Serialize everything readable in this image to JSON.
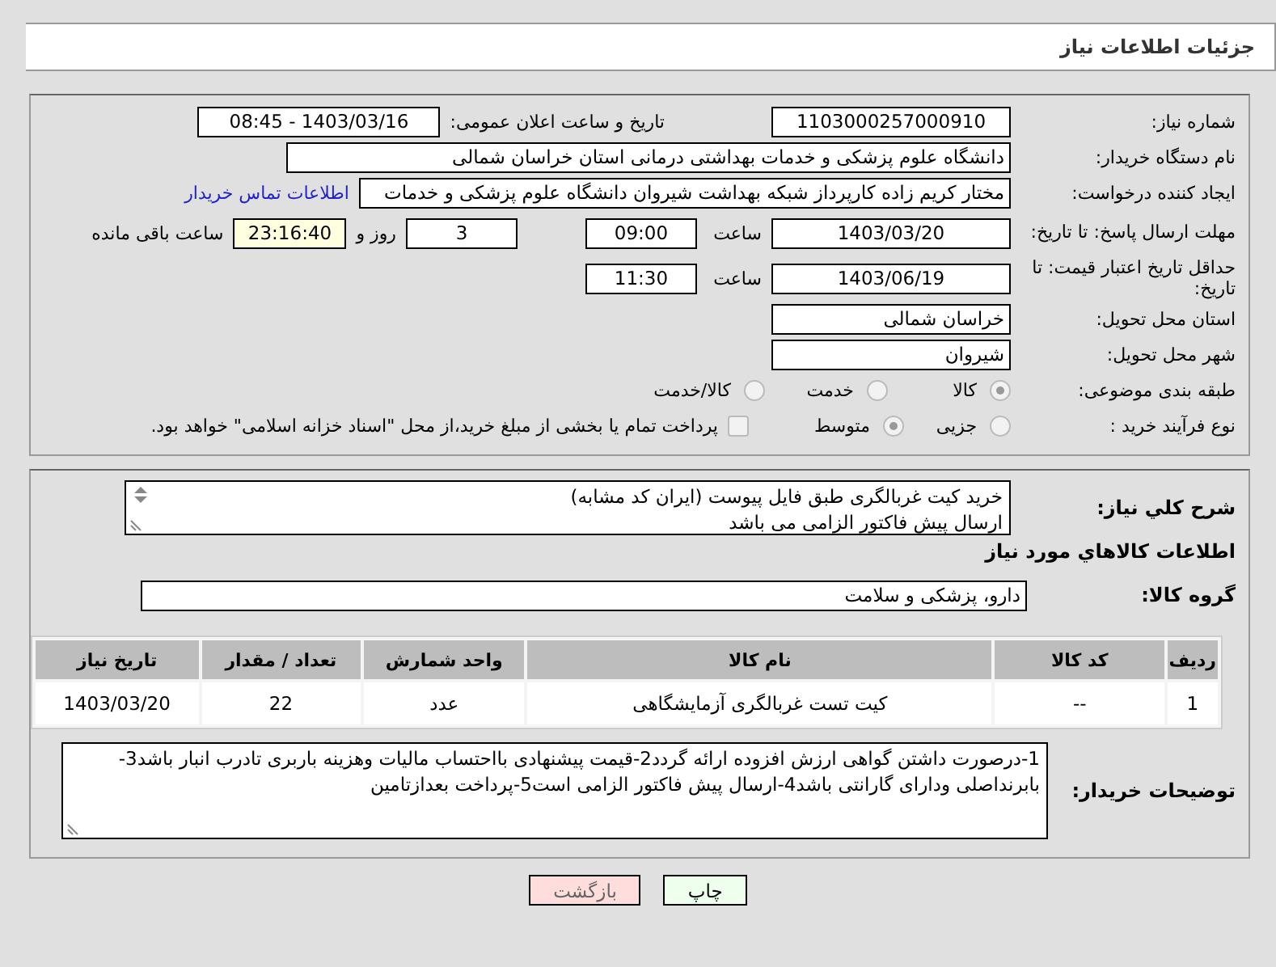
{
  "header": {
    "title": "جزئیات اطلاعات نیاز"
  },
  "need_number": {
    "label": "شماره نیاز:",
    "value": "1103000257000910"
  },
  "announce": {
    "label": "تاریخ و ساعت اعلان عمومی:",
    "value": "1403/03/16 - 08:45"
  },
  "buyer_org": {
    "label": "نام دستگاه خریدار:",
    "value": "دانشگاه علوم پزشکی و خدمات بهداشتی درمانی استان خراسان شمالی"
  },
  "requester": {
    "label": "ایجاد کننده درخواست:",
    "value": "مختار کریم زاده کارپرداز شبکه بهداشت شیروان دانشگاه علوم پزشکی و خدمات",
    "link": "اطلاعات تماس خریدار"
  },
  "reply_deadline": {
    "label": "مهلت ارسال پاسخ: تا تاریخ:",
    "date": "1403/03/20",
    "time_label": "ساعت",
    "time": "09:00",
    "days": "3",
    "days_label": "روز و",
    "remaining": "23:16:40",
    "remaining_label": "ساعت باقی مانده"
  },
  "price_validity": {
    "label": "حداقل تاریخ اعتبار قیمت: تا تاریخ:",
    "date": "1403/06/19",
    "time_label": "ساعت",
    "time": "11:30"
  },
  "province": {
    "label": "استان محل تحویل:",
    "value": "خراسان شمالی"
  },
  "city": {
    "label": "شهر محل تحویل:",
    "value": "شیروان"
  },
  "category": {
    "label": "طبقه بندی موضوعی:",
    "options": [
      {
        "label": "کالا",
        "selected": true
      },
      {
        "label": "خدمت",
        "selected": false
      },
      {
        "label": "کالا/خدمت",
        "selected": false
      }
    ]
  },
  "process": {
    "label": "نوع فرآیند خرید :",
    "options": [
      {
        "label": "جزیی",
        "selected": false
      },
      {
        "label": "متوسط",
        "selected": true
      }
    ],
    "payment": {
      "label": "پرداخت تمام یا بخشی از مبلغ خرید،از محل \"اسناد خزانه اسلامی\" خواهد بود.",
      "checked": false
    }
  },
  "description": {
    "label": "شرح کلي نياز:",
    "lines": [
      "خرید کیت غربالگری طبق فایل پیوست (ایران کد مشابه)",
      "ارسال پیش فاکتور الزامی می باشد"
    ]
  },
  "goods_heading": "اطلاعات کالاهاي مورد نياز",
  "goods_group": {
    "label": "گروه کالا:",
    "value": "دارو، پزشکی و سلامت"
  },
  "table": {
    "columns": [
      "ردیف",
      "کد کالا",
      "نام کالا",
      "واحد شمارش",
      "تعداد / مقدار",
      "تاریخ نیاز"
    ],
    "rows": [
      [
        "1",
        "--",
        "کیت تست غربالگری آزمایشگاهی",
        "عدد",
        "22",
        "1403/03/20"
      ]
    ]
  },
  "buyer_notes": {
    "label": "توضیحات خریدار:",
    "value": "1-درصورت داشتن گواهی ارزش افزوده ارائه گردد2-قیمت پیشنهادی بااحتساب مالیات وهزینه باربری تادرب انبار باشد3-بابرنداصلی ودارای گارانتی باشد4-ارسال پیش فاکتور الزامی است5-پرداخت بعدازتامین"
  },
  "buttons": [
    {
      "label": "چاپ",
      "kind": "print"
    },
    {
      "label": "بازگشت",
      "kind": "back"
    }
  ]
}
